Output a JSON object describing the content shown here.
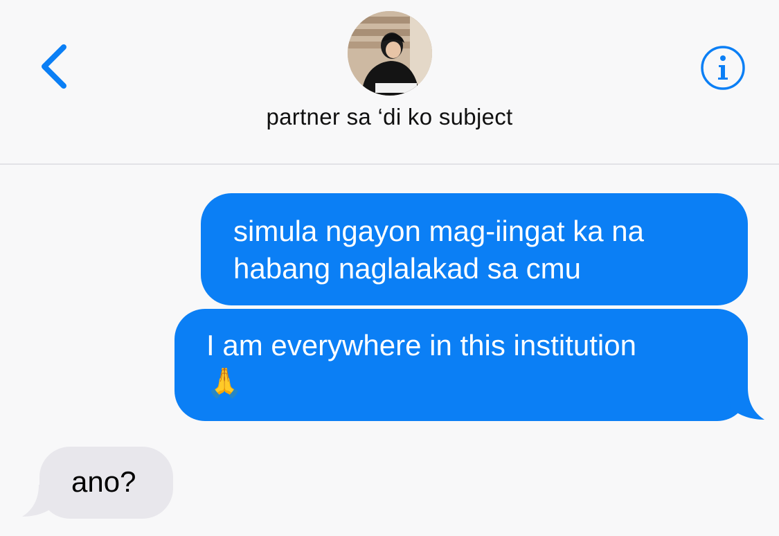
{
  "header": {
    "contact_name": "partner sa ‘di ko subject",
    "back_icon": "chevron-left-icon",
    "info_icon": "info-icon",
    "accent_color": "#0b7ff5"
  },
  "messages": [
    {
      "direction": "sent",
      "lines": [
        "simula ngayon mag-iingat ka na",
        "habang naglalakad sa cmu"
      ]
    },
    {
      "direction": "sent",
      "lines": [
        "I am everywhere in this institution",
        "🙏"
      ]
    },
    {
      "direction": "received",
      "lines": [
        "ano?"
      ]
    }
  ],
  "colors": {
    "sent_bubble": "#0b7ff5",
    "received_bubble": "#e8e7ec",
    "background": "#f8f8f9"
  }
}
